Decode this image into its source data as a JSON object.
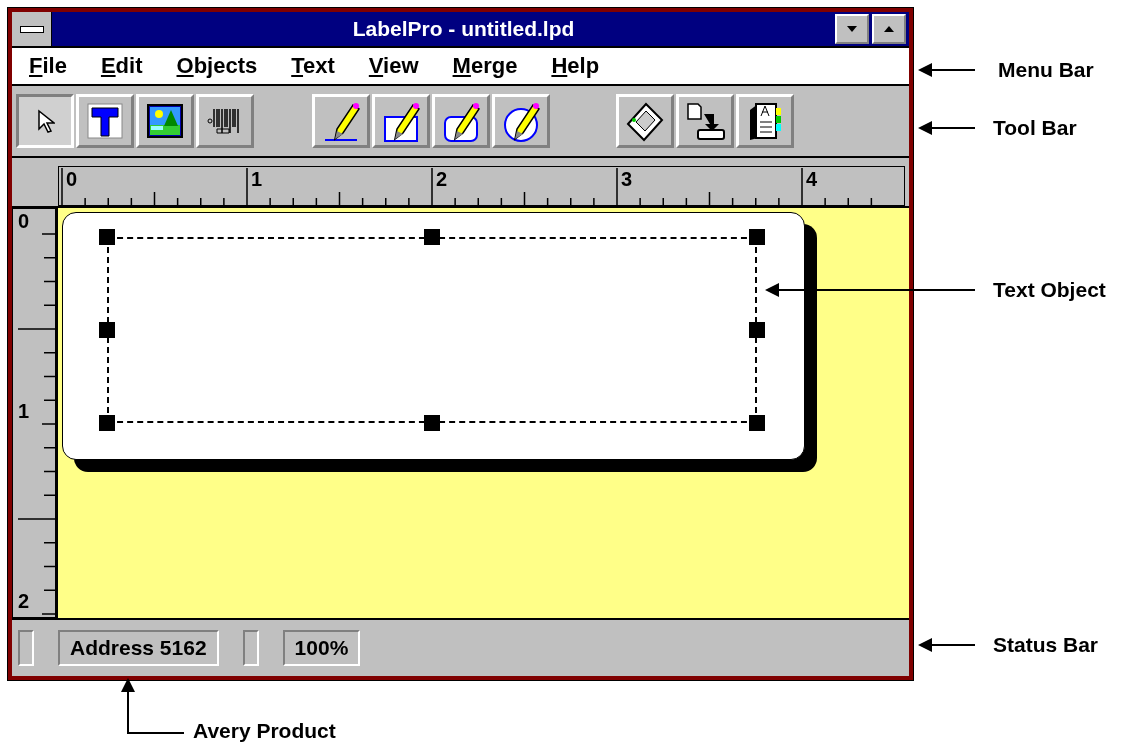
{
  "window": {
    "title": "LabelPro - untitled.lpd"
  },
  "menu": [
    "File",
    "Edit",
    "Objects",
    "Text",
    "View",
    "Merge",
    "Help"
  ],
  "toolbar": {
    "groups": [
      {
        "buttons": [
          {
            "selected": true
          },
          {
            "selected": false
          },
          {
            "selected": false
          },
          {
            "selected": false
          }
        ]
      },
      {
        "buttons": [
          {
            "selected": false
          },
          {
            "selected": false
          },
          {
            "selected": false
          },
          {
            "selected": false
          }
        ]
      },
      {
        "buttons": [
          {
            "selected": false
          },
          {
            "selected": false
          },
          {
            "selected": false
          }
        ]
      }
    ]
  },
  "ruler": {
    "horizontal": [
      "0",
      "1",
      "2",
      "3",
      "4"
    ],
    "vertical": [
      "0",
      "1",
      "2"
    ]
  },
  "label": {
    "selected": true
  },
  "status_bar": [
    "Address 5162",
    "100%"
  ],
  "callouts": [
    "Menu Bar",
    "Tool Bar",
    "Text Object",
    "Status Bar",
    "Avery Product"
  ]
}
